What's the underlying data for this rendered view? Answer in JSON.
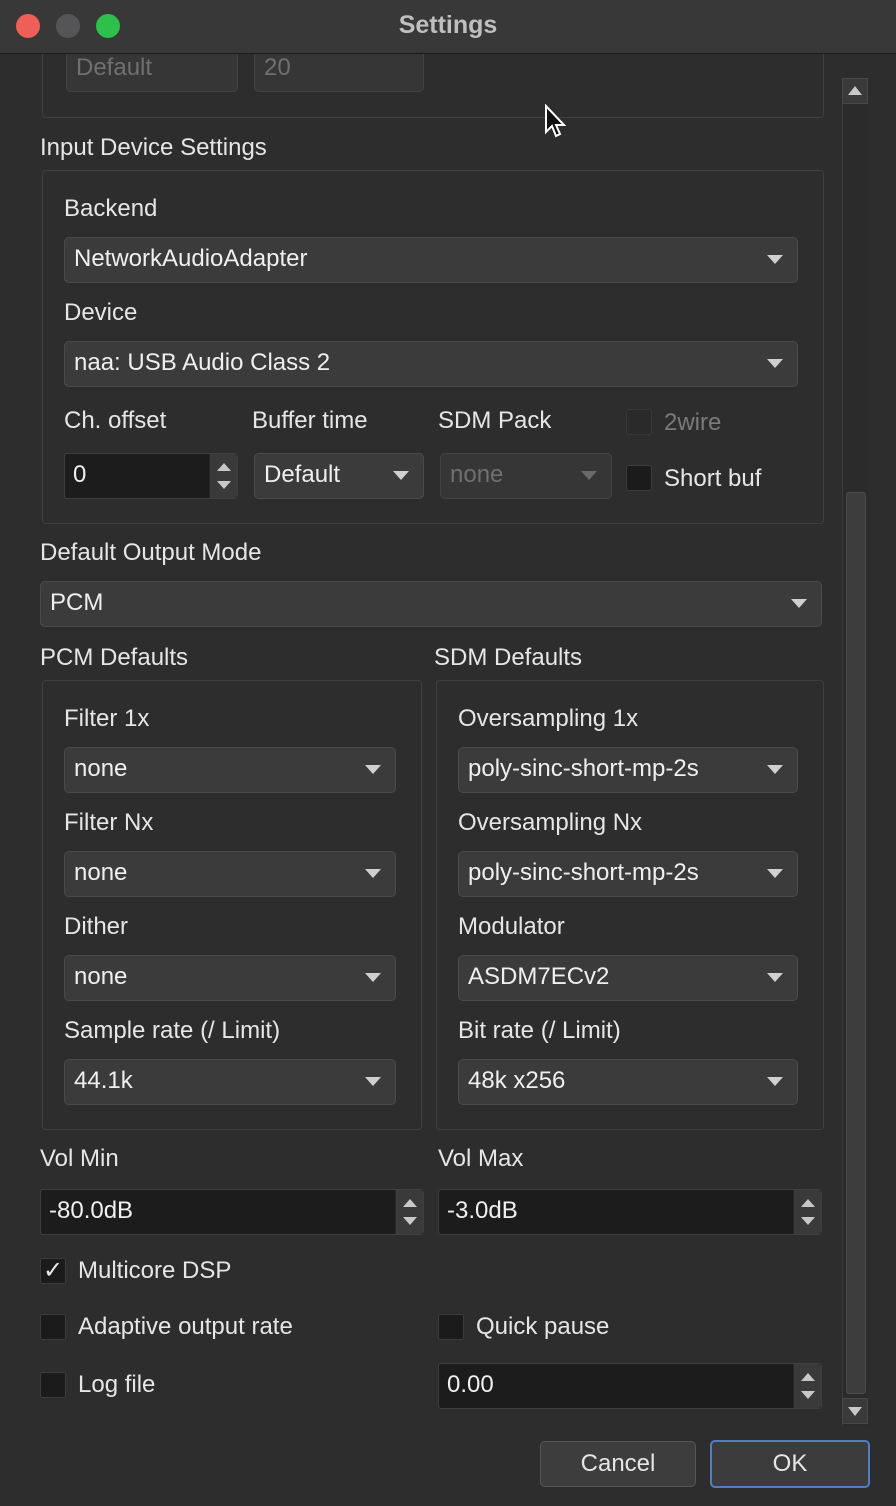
{
  "window": {
    "title": "Settings"
  },
  "top_partial": {
    "left_value": "Default",
    "right_value": "20"
  },
  "input_device": {
    "section_title": "Input Device Settings",
    "backend_label": "Backend",
    "backend_value": "NetworkAudioAdapter",
    "device_label": "Device",
    "device_value": "naa: USB Audio Class 2",
    "ch_offset_label": "Ch. offset",
    "ch_offset_value": "0",
    "buffer_time_label": "Buffer time",
    "buffer_time_value": "Default",
    "sdm_pack_label": "SDM Pack",
    "sdm_pack_value": "none",
    "twowire_label": "2wire",
    "short_buf_label": "Short buf"
  },
  "output_mode": {
    "label": "Default Output Mode",
    "value": "PCM"
  },
  "pcm": {
    "title": "PCM Defaults",
    "filter1x_label": "Filter 1x",
    "filter1x_value": "none",
    "filternx_label": "Filter Nx",
    "filternx_value": "none",
    "dither_label": "Dither",
    "dither_value": "none",
    "samplerate_label": "Sample rate (/ Limit)",
    "samplerate_value": "44.1k"
  },
  "sdm": {
    "title": "SDM Defaults",
    "os1x_label": "Oversampling 1x",
    "os1x_value": "poly-sinc-short-mp-2s",
    "osnx_label": "Oversampling Nx",
    "osnx_value": "poly-sinc-short-mp-2s",
    "modulator_label": "Modulator",
    "modulator_value": "ASDM7ECv2",
    "bitrate_label": "Bit rate (/ Limit)",
    "bitrate_value": "48k x256"
  },
  "volume": {
    "min_label": "Vol Min",
    "min_value": "-80.0dB",
    "max_label": "Vol Max",
    "max_value": "-3.0dB"
  },
  "options": {
    "multicore_label": "Multicore DSP",
    "multicore_checked": true,
    "adaptive_label": "Adaptive output rate",
    "quick_pause_label": "Quick pause",
    "log_file_label": "Log file",
    "log_value": "0.00"
  },
  "buttons": {
    "cancel": "Cancel",
    "ok": "OK"
  },
  "colors": {
    "accent": "#4f7fc2",
    "window_bg": "#2d2d2d",
    "titlebar": "#383838"
  }
}
